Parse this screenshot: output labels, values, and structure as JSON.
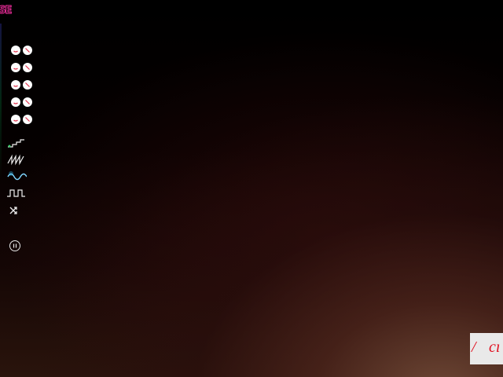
{
  "app": {
    "logo_text": "SE"
  },
  "toolbar": {
    "wave_rows": [
      {
        "left_icon": "minus-circle-icon",
        "right_icon": "slash-circle-icon"
      },
      {
        "left_icon": "minus-circle-icon",
        "right_icon": "slash-circle-icon"
      },
      {
        "left_icon": "minus-circle-icon",
        "right_icon": "slash-circle-icon"
      },
      {
        "left_icon": "minus-circle-icon",
        "right_icon": "slash-circle-icon"
      },
      {
        "left_icon": "minus-circle-icon",
        "right_icon": "slash-circle-icon"
      }
    ],
    "waveforms": [
      {
        "name": "staircase-wave-icon"
      },
      {
        "name": "sawtooth-wave-icon"
      },
      {
        "name": "sine-wave-icon"
      },
      {
        "name": "square-wave-icon"
      },
      {
        "name": "shuffle-icon"
      }
    ],
    "pause_icon": "pause-icon"
  },
  "corner_card": {
    "slash": "/",
    "text": "cı"
  },
  "colors": {
    "logo": "#ff2fa6",
    "accent_red": "#e01020",
    "icon_white": "#f0f0f0",
    "sine_active": "#7fd6ff"
  }
}
